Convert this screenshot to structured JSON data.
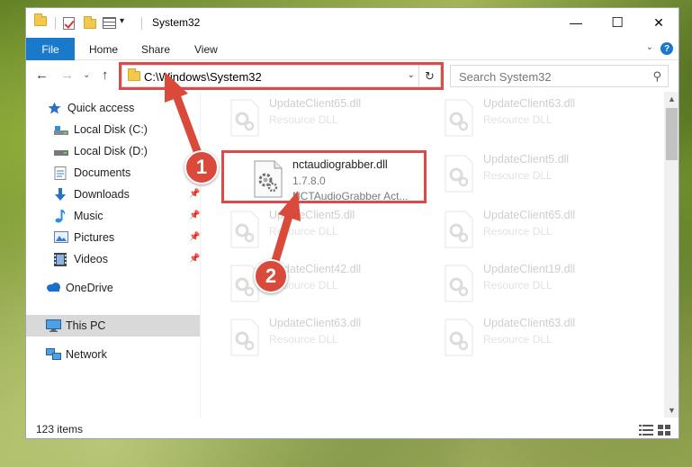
{
  "window": {
    "title": "System32",
    "minimize": "—",
    "maximize": "☐",
    "close": "✕"
  },
  "ribbon": {
    "tabs": [
      "File",
      "Home",
      "Share",
      "View"
    ],
    "help": "?",
    "expand": "⌄"
  },
  "nav": {
    "back": "←",
    "forward": "→",
    "recent": "⌄",
    "up": "↑",
    "address": "C:\\Windows\\System32",
    "address_dropdown": "⌄",
    "refresh": "↻",
    "search_placeholder": "Search System32",
    "search_icon": "⚲"
  },
  "sidebar": {
    "items": [
      {
        "label": "Quick access",
        "icon": "star-icon"
      },
      {
        "label": "Local Disk (C:)",
        "icon": "drive-icon"
      },
      {
        "label": "Local Disk (D:)",
        "icon": "drive-icon"
      },
      {
        "label": "Documents",
        "icon": "documents-icon",
        "pinned": true
      },
      {
        "label": "Downloads",
        "icon": "download-icon",
        "pinned": true
      },
      {
        "label": "Music",
        "icon": "music-icon",
        "pinned": true
      },
      {
        "label": "Pictures",
        "icon": "pictures-icon",
        "pinned": true
      },
      {
        "label": "Videos",
        "icon": "videos-icon",
        "pinned": true
      },
      {
        "label": "OneDrive",
        "icon": "cloud-icon"
      },
      {
        "label": "This PC",
        "icon": "computer-icon",
        "selected": true
      },
      {
        "label": "Network",
        "icon": "network-icon"
      }
    ]
  },
  "files": {
    "left": [
      {
        "name": "UpdateClient65.dll",
        "type": "Resource DLL"
      },
      {
        "name": "nctaudiograbber.dll",
        "version": "1.7.8.0",
        "type": "NCTAudioGrabber Act..."
      },
      {
        "name": "UpdateClient5.dll",
        "type": "Resource DLL"
      },
      {
        "name": "UpdateClient42.dll",
        "type": "Resource DLL"
      },
      {
        "name": "UpdateClient63.dll",
        "type": "Resource DLL"
      }
    ],
    "right": [
      {
        "name": "UpdateClient63.dll",
        "type": "Resource DLL"
      },
      {
        "name": "UpdateClient5.dll",
        "type": "Resource DLL"
      },
      {
        "name": "UpdateClient65.dll",
        "type": "Resource DLL"
      },
      {
        "name": "UpdateClient19.dll",
        "type": "Resource DLL"
      },
      {
        "name": "UpdateClient63.dll",
        "type": "Resource DLL"
      }
    ]
  },
  "status": {
    "item_count": "123 items"
  },
  "callouts": {
    "step1": "1",
    "step2": "2"
  },
  "colors": {
    "accent": "#1979ca",
    "callout": "#d94a3a",
    "highlight_box": "#dc4a4a"
  }
}
